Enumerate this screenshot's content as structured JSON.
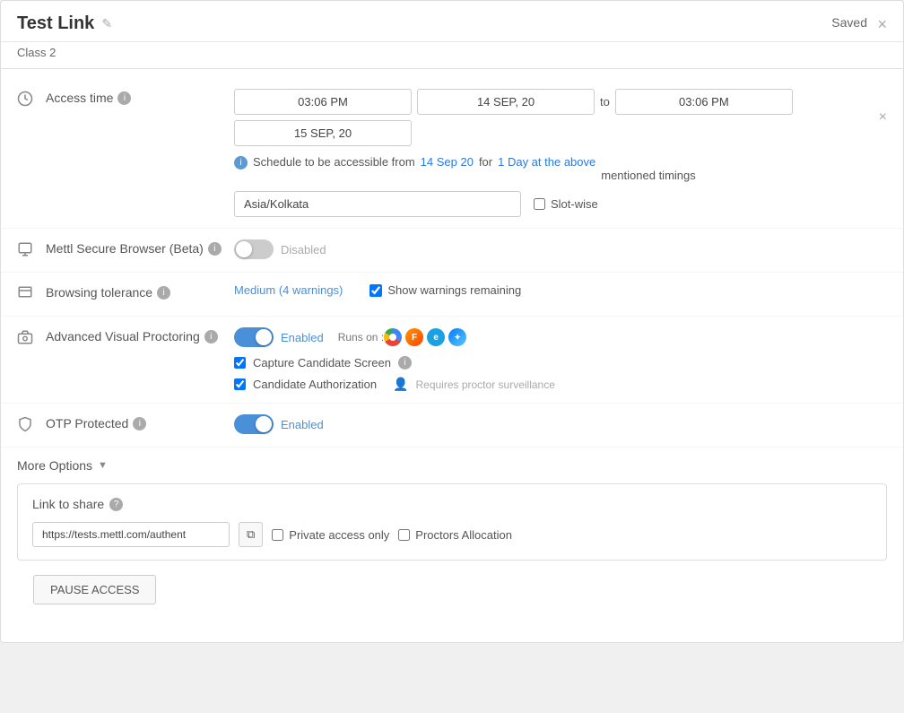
{
  "header": {
    "title": "Test Link",
    "subtitle": "Class 2",
    "saved_label": "Saved",
    "close_label": "×",
    "edit_icon": "✎"
  },
  "access_time": {
    "label": "Access time",
    "start_time": "03:06 PM",
    "start_date": "14 SEP, 20",
    "to_label": "to",
    "end_time": "03:06 PM",
    "end_date": "15 SEP, 20",
    "schedule_text_prefix": "Schedule to be accessible from",
    "schedule_date_link": "14 Sep 20",
    "schedule_for": "for",
    "schedule_duration_link": "1 Day at the above",
    "schedule_mentioned": "mentioned timings",
    "timezone_value": "Asia/Kolkata",
    "slot_wise_label": "Slot-wise"
  },
  "secure_browser": {
    "label": "Mettl Secure Browser (Beta)",
    "status": "Disabled",
    "enabled": false
  },
  "browsing_tolerance": {
    "label": "Browsing tolerance",
    "value": "Medium (4 warnings)",
    "show_warnings_label": "Show warnings remaining",
    "show_warnings_checked": true
  },
  "avp": {
    "label": "Advanced Visual Proctoring",
    "status": "Enabled",
    "enabled": true,
    "runs_on_label": "Runs on :",
    "capture_screen_label": "Capture Candidate Screen",
    "candidate_auth_label": "Candidate Authorization",
    "proctor_label": "Requires proctor surveillance",
    "browsers": [
      "Chrome",
      "Firefox",
      "IE",
      "Safari"
    ]
  },
  "otp": {
    "label": "OTP Protected",
    "status": "Enabled",
    "enabled": true
  },
  "more_options": {
    "label": "More Options"
  },
  "link_share": {
    "title": "Link to share",
    "url": "https://tests.mettl.com/authent",
    "private_access_label": "Private access only",
    "proctors_allocation_label": "Proctors Allocation"
  },
  "pause_btn": {
    "label": "PAUSE ACCESS"
  }
}
